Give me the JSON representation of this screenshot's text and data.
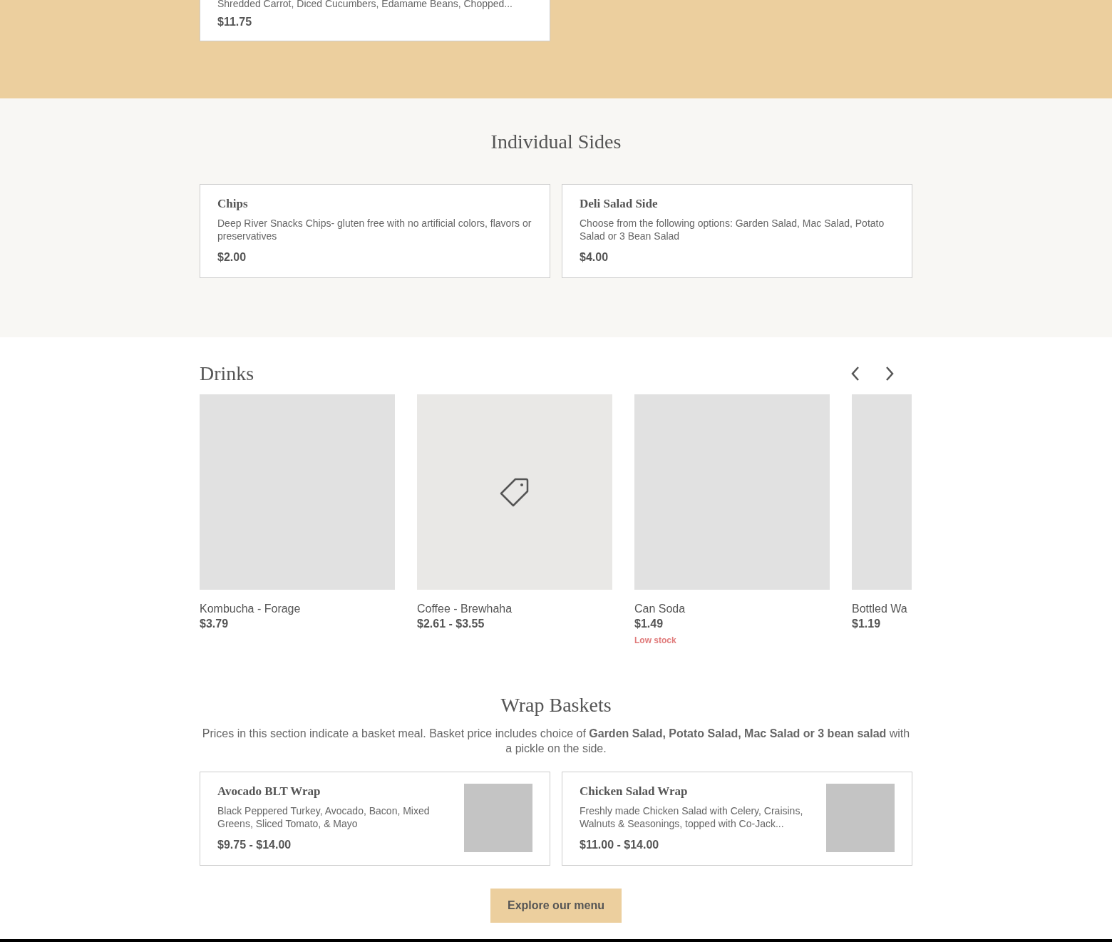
{
  "top_card": {
    "description": "Shredded Carrot, Diced Cucumbers, Edamame Beans, Chopped...",
    "price": "$11.75"
  },
  "sides": {
    "title": "Individual Sides",
    "items": [
      {
        "name": "Chips",
        "description": "Deep River Snacks Chips- gluten free with no artificial colors, flavors or preservatives",
        "price": "$2.00"
      },
      {
        "name": "Deli Salad Side",
        "description": "Choose from the following options: Garden Salad, Mac Salad, Potato Salad or 3 Bean Salad",
        "price": "$4.00"
      }
    ]
  },
  "drinks": {
    "title": "Drinks",
    "items": [
      {
        "name": "Kombucha - Forage",
        "price": "$3.79",
        "has_icon": false
      },
      {
        "name": "Coffee - Brewhaha",
        "price": "$2.61 - $3.55",
        "has_icon": true
      },
      {
        "name": "Can Soda",
        "price": "$1.49",
        "has_icon": false,
        "stock_note": "Low stock"
      },
      {
        "name": "Bottled Wa",
        "price": "$1.19",
        "has_icon": false
      }
    ]
  },
  "wraps": {
    "title": "Wrap Baskets",
    "note": "Prices in this section indicate a basket meal. Basket price includes choice of **Garden Salad, Potato Salad, Mac Salad or 3 bean salad** with a pickle on the side.",
    "items": [
      {
        "name": "Avocado BLT Wrap",
        "description": "Black Peppered Turkey, Avocado, Bacon, Mixed Greens, Sliced Tomato, & Mayo",
        "price": "$9.75 - $14.00"
      },
      {
        "name": "Chicken Salad Wrap",
        "description": "Freshly made Chicken Salad with Celery, Craisins, Walnuts & Seasonings, topped with Co-Jack...",
        "price": "$11.00 - $14.00"
      }
    ]
  },
  "cta": "Explore our menu"
}
